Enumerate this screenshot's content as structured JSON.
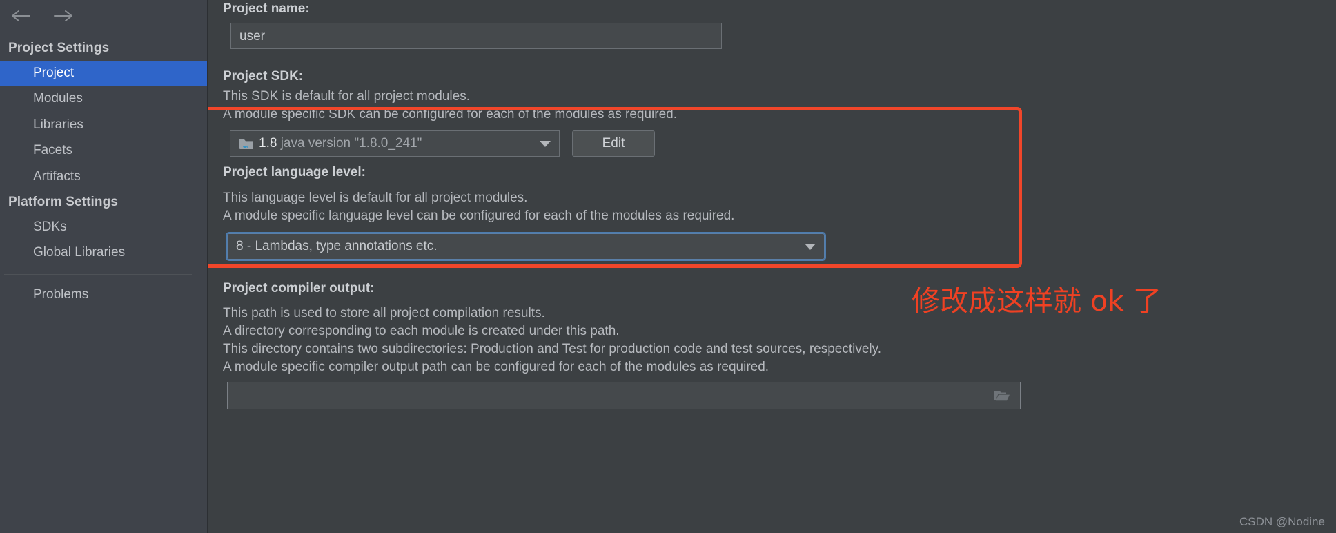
{
  "sidebar": {
    "back_icon": "arrow-left-icon",
    "forward_icon": "arrow-right-icon",
    "groups": [
      {
        "title": "Project Settings",
        "items": [
          {
            "label": "Project",
            "selected": true
          },
          {
            "label": "Modules",
            "selected": false
          },
          {
            "label": "Libraries",
            "selected": false
          },
          {
            "label": "Facets",
            "selected": false
          },
          {
            "label": "Artifacts",
            "selected": false
          }
        ]
      },
      {
        "title": "Platform Settings",
        "items": [
          {
            "label": "SDKs",
            "selected": false
          },
          {
            "label": "Global Libraries",
            "selected": false
          }
        ]
      }
    ],
    "extra_items": [
      {
        "label": "Problems",
        "selected": false
      }
    ]
  },
  "main": {
    "project_name": {
      "label": "Project name:",
      "value": "user"
    },
    "project_sdk": {
      "label": "Project SDK:",
      "desc_line_1": "This SDK is default for all project modules.",
      "desc_line_2": "A module specific SDK can be configured for each of the modules as required.",
      "combo_icon": "java-sdk-folder-icon",
      "combo_name": "1.8",
      "combo_version": "java version \"1.8.0_241\"",
      "caret_icon": "chevron-down-icon",
      "edit_button": "Edit"
    },
    "language_level": {
      "label": "Project language level:",
      "desc_line_1": "This language level is default for all project modules.",
      "desc_line_2": "A module specific language level can be configured for each of the modules as required.",
      "value": "8 - Lambdas, type annotations etc.",
      "caret_icon": "chevron-down-icon"
    },
    "compiler_output": {
      "label": "Project compiler output:",
      "desc_line_1": "This path is used to store all project compilation results.",
      "desc_line_2": "A directory corresponding to each module is created under this path.",
      "desc_line_3": "This directory contains two subdirectories: Production and Test for production code and test sources, respectively.",
      "desc_line_4": "A module specific compiler output path can be configured for each of the modules as required.",
      "value": "",
      "browse_icon": "folder-open-icon"
    }
  },
  "annotation": {
    "text": "修改成这样就 ok 了",
    "color": "#ef4123"
  },
  "highlight": {
    "color": "#f1462a"
  },
  "watermark": {
    "text": "CSDN @Nodine"
  },
  "colors": {
    "accent_selection": "#2f65c9",
    "panel_bg": "#3c4043",
    "sidebar_bg": "#3f434a",
    "field_bg": "#45494c",
    "focus_ring": "#4c7caf",
    "java_cup": "#3592c4"
  }
}
